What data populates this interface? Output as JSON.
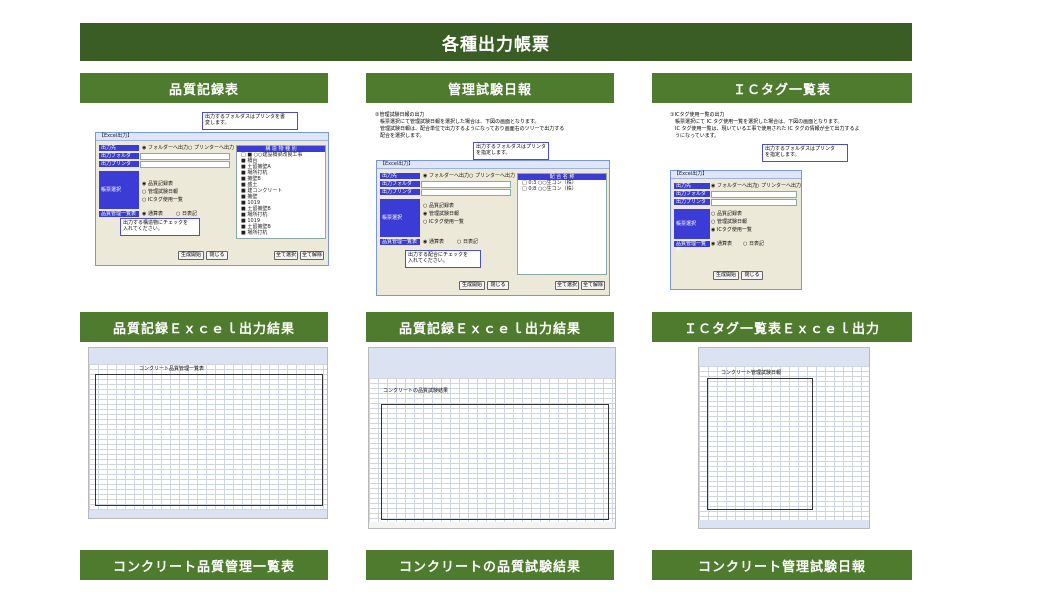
{
  "page": {
    "banner": "各種出力帳票"
  },
  "sections": [
    {
      "title": "品質記録表"
    },
    {
      "title": "管理試験日報"
    },
    {
      "title": "ＩＣタグ一覧表"
    },
    {
      "title": "品質記録Ｅｘｃｅｌ出力結果"
    },
    {
      "title": "品質記録Ｅｘｃｅｌ出力結果"
    },
    {
      "title": "ＩＣタグ一覧表Ｅｘｃｅｌ出力"
    },
    {
      "title": "コンクリート品質管理一覧表"
    },
    {
      "title": "コンクリートの品質試験結果"
    },
    {
      "title": "コンクリート管理試験日報"
    }
  ],
  "shot1": {
    "window_title": "【Excel出力】",
    "callout_top": "出力するフォルダスはプリンタを書\n変します。",
    "callout_bottom": "出力する構造物にチェックを\n入れてください。",
    "label_dest": "出力先",
    "label_path": "出力フォルダ",
    "label_printer": "出力プリンタ",
    "label_select": "帳票選択",
    "label_list": "品質管理一覧表",
    "radio_folder": "◉ フォルダーへ出力",
    "radio_printer": "○ プリンターへ出力",
    "opt1": "◉ 品質記録表",
    "opt2": "○ 管理試験日報",
    "opt3": "○ ICタグ使用一覧",
    "opt4": "◉ 通算表",
    "opt5": "○ 日表記",
    "tree_head": "構  造  物  種  別",
    "tree_items": [
      "□ ■ ○○建設橋梁改良工事",
      "  ■ 橋台",
      "    ■ 土留擁壁A",
      "    ■ 場所打杭",
      "    ■ 擁壁B",
      "    ■ 盛土",
      "  ■ 建コンクリート",
      "  ■ 擁壁",
      "  ■ 1019",
      "    ■ 土留擁壁B",
      "    ■ 場所打杭",
      "  ■ 1019",
      "    ■ 土留擁壁B",
      "    ■ 場所打杭"
    ],
    "btn_start": "生成開始",
    "btn_close": "閉じる",
    "btn_all": "全て選択",
    "btn_clear": "全て解除"
  },
  "shot2": {
    "note1": "②管理試験日報の出力",
    "note2": "　帳票選択にて管理試験日報を選択した場合は、下図の画面となります。",
    "note3": "　管理試験日報は、配合単位で出力するようになっており画面右のツリーで出力する",
    "note4": "　配合を選択します。",
    "window_title": "【Excel出力】",
    "callout_top": "出力するフォルダスはプリンタ\nを指定します。",
    "callout_bottom": "出力する配合にチェックを\n入れてください。",
    "label_dest": "出力先",
    "label_path": "出力フォルダ",
    "label_printer": "出力プリンタ",
    "label_select": "帳票選択",
    "label_list": "品質管理一覧表",
    "radio_folder": "◉ フォルダーへ出力",
    "radio_printer": "○ プリンターへ出力",
    "opt1": "○ 品質記録表",
    "opt2": "◉ 管理試験日報",
    "opt3": "○ ICタグ使用一覧",
    "opt4": "◉ 通算表",
    "opt5": "○ 日表記",
    "tree_head": "配  合  名  称",
    "tree_items": [
      "□ 0:3  ○○生コン（株）",
      "□ 0:8  ○○生コン（株）"
    ],
    "btn_start": "生成開始",
    "btn_close": "閉じる",
    "btn_all": "全て選択",
    "btn_clear": "全て解除"
  },
  "shot3": {
    "note1": "①ICタグ使用一覧の出力",
    "note2": "　帳票選択にて IC タグ使用一覧を選択した場合は、下図の画面となります。",
    "note3": "　IC タグ使用一覧は、現いている工事で使用された IC タグの情報が全て出力するよ",
    "note4": "　うになっています。",
    "window_title": "【Excel出力】",
    "callout_top": "出力するフォルダスはプリンタ\nを指定します。",
    "label_dest": "出力先",
    "label_path": "出力フォルダ",
    "label_printer": "出力プリンタ",
    "label_select": "帳票選択",
    "label_list": "品質管理一覧表",
    "radio_folder": "◉ フォルダーへ出力",
    "radio_printer": "○ プリンターへ出力",
    "opt1": "○ 品質記録表",
    "opt2": "○ 管理試験日報",
    "opt3": "◉ ICタグ使用一覧",
    "opt4": "◉ 通算表",
    "opt5": "○ 日表記",
    "btn_start": "生成開始",
    "btn_close": "閉じる"
  },
  "excel1": {
    "sheet_title": "コンクリート品質管理一覧表"
  },
  "excel2": {
    "sheet_title": "コンクリートの品質試験結果"
  },
  "excel3": {
    "sheet_title": "コンクリート管理試験日報"
  }
}
